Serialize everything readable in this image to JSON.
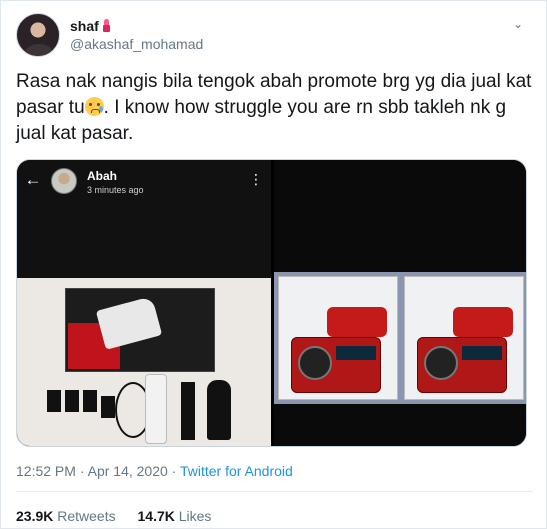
{
  "user": {
    "display_name": "shaf",
    "handle": "@akashaf_mohamad",
    "name_icon": "lipstick-icon"
  },
  "tweet": {
    "text_part1": "Rasa nak nangis bila tengok abah promote brg yg dia jual kat pasar tu",
    "emoji": "crying-face-icon",
    "text_part2": ". I know how struggle you are rn sbb takleh nk g jual kat pasar."
  },
  "media": {
    "left_photo": {
      "story_name": "Abah",
      "story_time": "3 minutes ago"
    }
  },
  "meta": {
    "time": "12:52 PM",
    "separator": " · ",
    "date": "Apr 14, 2020",
    "client": "Twitter for Android"
  },
  "stats": {
    "retweets_count": "23.9K",
    "retweets_label": "Retweets",
    "likes_count": "14.7K",
    "likes_label": "Likes"
  },
  "colors": {
    "link": "#1b95e0",
    "secondary_text": "#657786",
    "primary_text": "#14171a"
  }
}
